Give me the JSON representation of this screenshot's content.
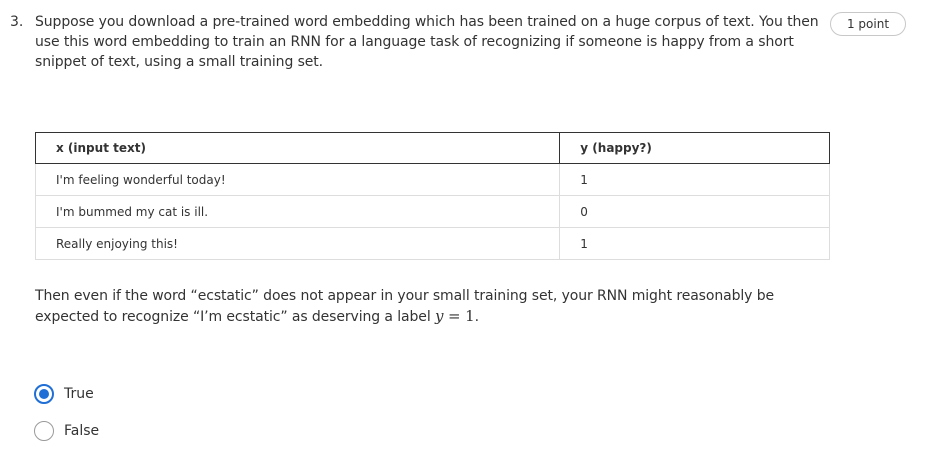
{
  "question": {
    "number": "3.",
    "text": "Suppose you download a pre-trained word embedding which has been trained on a huge corpus of text. You then use this word embedding to train an RNN for a language task of recognizing if someone is happy from a short snippet of text, using a small training set.",
    "points": "1 point"
  },
  "table": {
    "headers": [
      "x (input text)",
      "y (happy?)"
    ],
    "rows": [
      [
        "I'm feeling wonderful today!",
        "1"
      ],
      [
        "I'm bummed my cat is ill.",
        "0"
      ],
      [
        "Really enjoying this!",
        "1"
      ]
    ]
  },
  "statement": {
    "text": "Then even if the word “ecstatic” does not appear in your small training set, your RNN might reasonably be expected to recognize “I’m ecstatic” as deserving a label ",
    "math_var": "y",
    "math_rest": " = 1",
    "end": "."
  },
  "options": [
    {
      "label": "True",
      "selected": true
    },
    {
      "label": "False",
      "selected": false
    }
  ]
}
